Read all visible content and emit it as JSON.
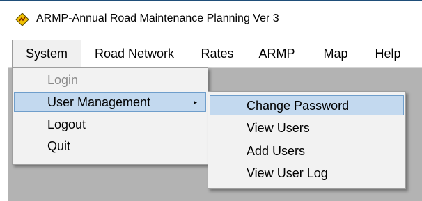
{
  "window": {
    "title": "ARMP-Annual Road Maintenance Planning Ver 3",
    "icon": "road-sign-icon"
  },
  "menubar": {
    "items": [
      {
        "label": "System",
        "active": true
      },
      {
        "label": "Road Network"
      },
      {
        "label": "Rates"
      },
      {
        "label": "ARMP"
      },
      {
        "label": "Map"
      },
      {
        "label": "Help"
      }
    ]
  },
  "system_menu": {
    "items": [
      {
        "label": "Login",
        "enabled": false
      },
      {
        "label": "User Management",
        "has_submenu": true,
        "highlighted": true
      },
      {
        "label": "Logout"
      },
      {
        "label": "Quit"
      }
    ],
    "submenu_arrow": "▸"
  },
  "user_management_menu": {
    "items": [
      {
        "label": "Change Password",
        "highlighted": true
      },
      {
        "label": "View Users"
      },
      {
        "label": "Add Users"
      },
      {
        "label": "View User Log"
      }
    ]
  },
  "colors": {
    "menu_highlight": "#c3d9ef",
    "menu_highlight_border": "#6f9ecb",
    "client_background": "#b3b3b3",
    "disabled_text": "#8a8a8a"
  }
}
